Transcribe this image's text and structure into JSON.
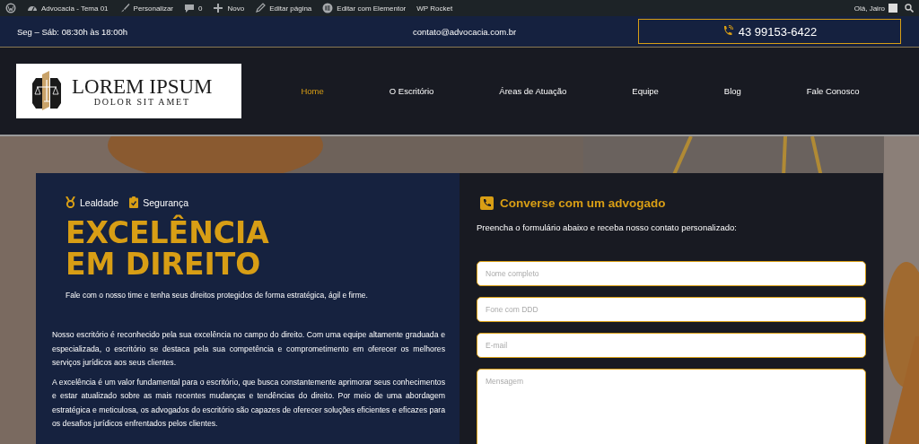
{
  "admin_bar": {
    "items": [
      {
        "kind": "wp"
      },
      {
        "kind": "home",
        "label": "Advocacia - Tema 01"
      },
      {
        "kind": "brush",
        "label": "Personalizar"
      },
      {
        "kind": "comment",
        "label": "0"
      },
      {
        "kind": "plus",
        "label": "Novo"
      },
      {
        "kind": "pencil",
        "label": "Editar página"
      },
      {
        "kind": "elementor",
        "label": "Editar com Elementor"
      },
      {
        "kind": "text",
        "label": "WP Rocket"
      }
    ],
    "user": "Olá, Jairo"
  },
  "top_bar": {
    "hours": "Seg – Sáb: 08:30h às 18:00h",
    "email": "contato@advocacia.com.br",
    "phone": "43 99153-6422"
  },
  "header": {
    "logo": {
      "title": "LOREM IPSUM",
      "subtitle": "DOLOR SIT AMET"
    },
    "nav": [
      {
        "label": "Home",
        "selected": true
      },
      {
        "label": "O Escritório",
        "selected": false
      },
      {
        "label": "Áreas de Atuação",
        "selected": false
      },
      {
        "label": "Equipe",
        "selected": false
      },
      {
        "label": "Blog",
        "selected": false
      },
      {
        "label": "Fale Conosco",
        "selected": false
      }
    ]
  },
  "hero": {
    "badges": [
      {
        "kind": "medal",
        "label": "Lealdade"
      },
      {
        "kind": "clipboard",
        "label": "Segurança"
      }
    ],
    "headline": [
      "EXCELÊNCIA",
      "EM DIREITO"
    ],
    "tagline": "Fale com o nosso time e tenha seus direitos protegidos de forma estratégica, ágil e firme.",
    "paragraphs": [
      "Nosso escritório é reconhecido pela sua excelência no campo do direito. Com uma equipe altamente graduada e especializada, o escritório se destaca pela sua competência e comprometimento em oferecer os melhores serviços jurídicos aos seus clientes.",
      "A excelência é um valor fundamental para o escritório, que busca constantemente aprimorar seus conhecimentos e estar atualizado sobre as mais recentes mudanças e tendências do direito. Por meio de uma abordagem estratégica e meticulosa, os advogados do escritório são capazes de oferecer soluções eficientes e eficazes para os desafios jurídicos enfrentados pelos clientes."
    ]
  },
  "contact_form": {
    "title": "Converse com um advogado",
    "subtitle": "Preencha o formulário abaixo e receba nosso contato personalizado:",
    "fields": [
      {
        "kind": "input",
        "placeholder": "Nome completo"
      },
      {
        "kind": "input",
        "placeholder": "Fone com DDD"
      },
      {
        "kind": "input",
        "placeholder": "E-mail"
      },
      {
        "kind": "textarea",
        "placeholder": "Mensagem"
      }
    ]
  }
}
